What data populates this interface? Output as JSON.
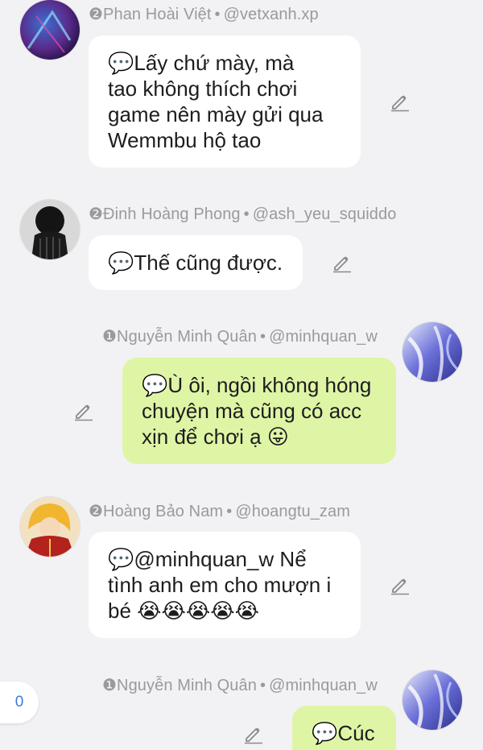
{
  "messages": [
    {
      "rank": "❷",
      "name": "Phan Hoài Việt",
      "handle": "@vetxanh.xp",
      "lines": [
        "💬Lấy chứ mày, mà",
        "tao không thích chơi",
        "game nên mày gửi qua",
        "Wemmbu hộ tao"
      ],
      "side": "left",
      "bubble_color": "#ffffff"
    },
    {
      "rank": "❷",
      "name": "Đinh Hoàng Phong",
      "handle": "@ash_yeu_squiddo",
      "lines": [
        "💬Thế cũng được."
      ],
      "side": "left",
      "bubble_color": "#ffffff"
    },
    {
      "rank": "❶",
      "name": "Nguyễn Minh Quân",
      "handle": "@minhquan_w",
      "lines": [
        "💬Ù ôi, ngồi không hóng",
        "chuyện mà cũng có acc",
        "xịn để chơi ạ 😛"
      ],
      "side": "right",
      "bubble_color": "#dff5a6"
    },
    {
      "rank": "❷",
      "name": "Hoàng Bảo Nam",
      "handle": "@hoangtu_zam",
      "lines": [
        "💬@minhquan_w Nể",
        "tình anh em cho mượn i",
        "bé 😭😭😭😭😭"
      ],
      "side": "left",
      "bubble_color": "#ffffff"
    },
    {
      "rank": "❶",
      "name": "Nguyễn Minh Quân",
      "handle": "@minhquan_w",
      "lines": [
        "💬Cúc"
      ],
      "side": "right",
      "bubble_color": "#dff5a6"
    }
  ],
  "separator": "•",
  "count_badge": "0",
  "icons": {
    "edit": "pencil-icon",
    "avatar": "avatar"
  },
  "colors": {
    "background": "#f2f2f4",
    "meta_text": "#9a9a9e",
    "own_bubble": "#dff5a6",
    "other_bubble": "#ffffff",
    "badge_text": "#3b7bd6"
  }
}
